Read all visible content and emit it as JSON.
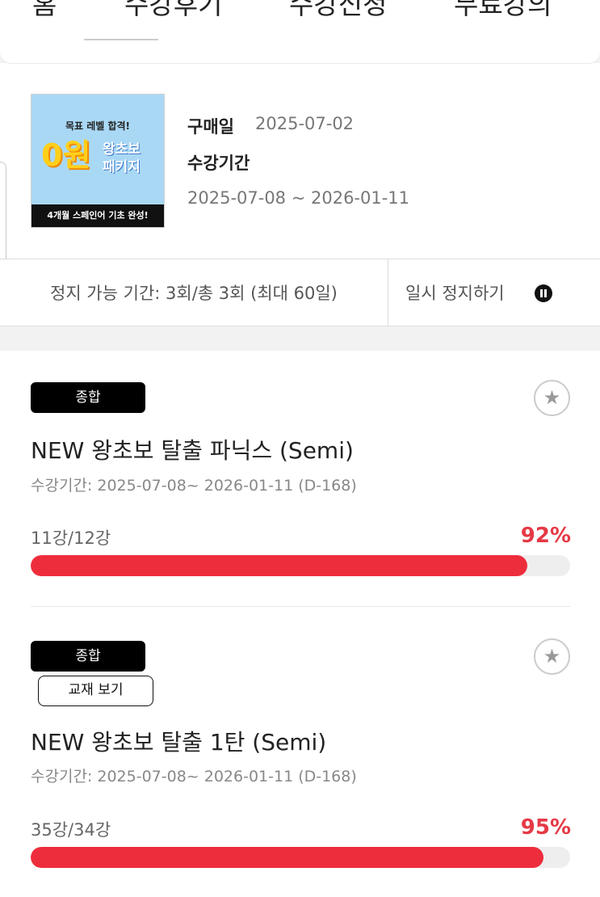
{
  "nav": {
    "tabs": [
      "홈",
      "수강후기",
      "수강신청",
      "무료강의"
    ]
  },
  "package": {
    "thumb": {
      "line1": "목표 레벨 합격!",
      "zero": "0원",
      "pk1": "왕초보",
      "pk2": "패키지",
      "bottom": "4개월 스페인어 기초 완성!"
    },
    "purchase_label": "구매일",
    "purchase_date": "2025-07-02",
    "period_label": "수강기간",
    "period": "2025-07-08 ~ 2026-01-11"
  },
  "pause": {
    "count_text": "정지 가능 기간: 3회/총 3회 (최대 60일)",
    "button_label": "일시 정지하기"
  },
  "courses": [
    {
      "badge": "종합",
      "title": "NEW 왕초보 탈출 파닉스 (Semi)",
      "period": "수강기간: 2025-07-08~ 2026-01-11 (D-168)",
      "lessons": "11강/12강",
      "percent_label": "92%",
      "progress": 0.92
    },
    {
      "badge": "종합",
      "book_button": "교재 보기",
      "title": "NEW 왕초보 탈출 1탄 (Semi)",
      "period": "수강기간: 2025-07-08~ 2026-01-11 (D-168)",
      "lessons": "35강/34강",
      "percent_label": "95%",
      "progress": 0.95
    }
  ],
  "colors": {
    "accent": "#ee2d3c",
    "percent_text": "#e63946",
    "badge_bg": "#000000"
  },
  "icons": {
    "favorite": "star-icon",
    "pause": "pause-icon"
  }
}
